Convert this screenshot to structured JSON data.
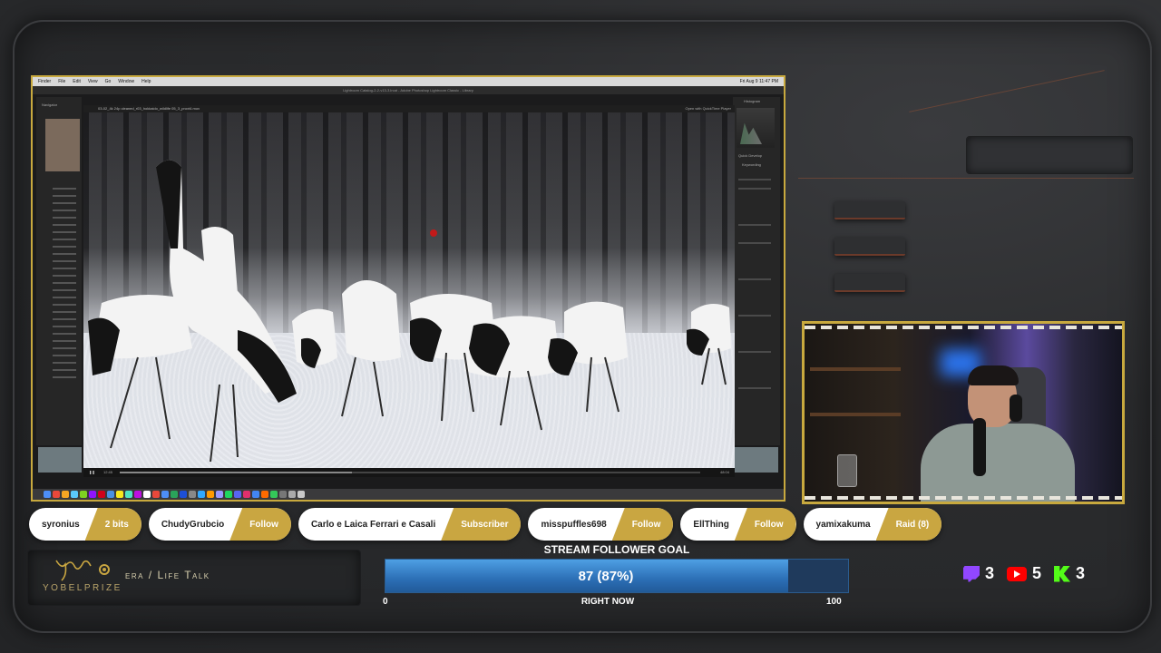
{
  "desktop": {
    "menubar": {
      "items": [
        "Finder",
        "File",
        "Edit",
        "View",
        "Go",
        "Window",
        "Help"
      ],
      "clock": "Fri Aug 9 11:47 PM"
    },
    "lightroom_title": "Lightroom Catalog-2-2-v13-3.lrcat - Adobe Photoshop Lightroom Classic - Library",
    "lightroom_panels": {
      "navigator": "Navigator",
      "histogram": "Histogram",
      "quick_develop": "Quick Develop",
      "keywording": "Keywording"
    },
    "quicktime": {
      "file_name": "03-02_4k 24p cleaned_r03_hokkaido_wildlife 05_3_proxt4.mov",
      "open_with_label": "Open with QuickTime Player",
      "current_time": "12:45",
      "end_time": "48:04",
      "progress": 0.4
    }
  },
  "events": [
    {
      "user": "syronius",
      "event": "2 bits"
    },
    {
      "user": "ChudyGrubcio",
      "event": "Follow"
    },
    {
      "user": "Carlo e Laica Ferrari e Casali",
      "event": "Subscriber"
    },
    {
      "user": "misspuffles698",
      "event": "Follow"
    },
    {
      "user": "EllThing",
      "event": "Follow"
    },
    {
      "user": "yamixakuma",
      "event": "Raid (8)"
    }
  ],
  "brand": {
    "name": "YOBELPRIZE",
    "topic": "era / Life Talk"
  },
  "goal": {
    "title": "STREAM FOLLOWER GOAL",
    "current": 87,
    "label": "87 (87%)",
    "min": "0",
    "max": "100",
    "max_value": 100,
    "center_label": "RIGHT NOW"
  },
  "stats": {
    "twitch": "3",
    "youtube": "5",
    "kick": "3"
  },
  "colors": {
    "accent_gold": "#c9a641",
    "goal_blue": "#2c6fb6",
    "twitch": "#9147ff",
    "youtube": "#ff0000",
    "kick": "#53fc18"
  }
}
